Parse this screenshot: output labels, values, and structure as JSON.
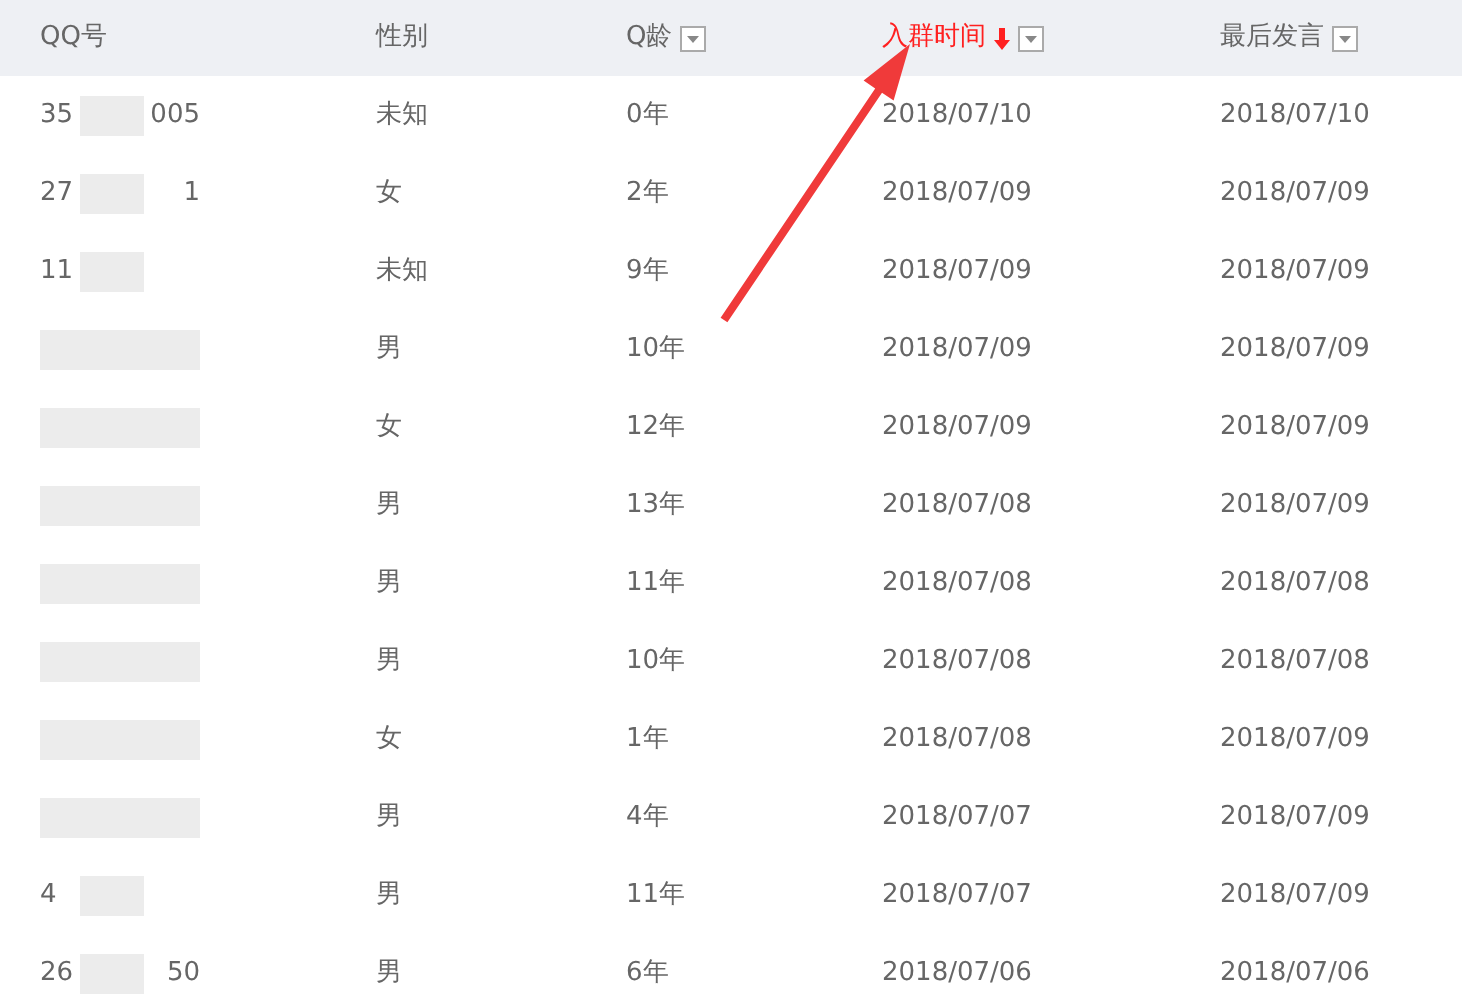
{
  "table": {
    "columns": [
      {
        "label": "QQ号",
        "filter": false,
        "sorted": false
      },
      {
        "label": "性别",
        "filter": false,
        "sorted": false
      },
      {
        "label": "Q龄",
        "filter": true,
        "sorted": false
      },
      {
        "label": "入群时间",
        "filter": true,
        "sorted": true
      },
      {
        "label": "最后发言",
        "filter": true,
        "sorted": false
      }
    ],
    "rows": [
      {
        "qq": {
          "start": "35",
          "end": "005"
        },
        "gender": "未知",
        "age": "0年",
        "joined": "2018/07/10",
        "last": "2018/07/10"
      },
      {
        "qq": {
          "start": "27",
          "end": "1"
        },
        "gender": "女",
        "age": "2年",
        "joined": "2018/07/09",
        "last": "2018/07/09"
      },
      {
        "qq": {
          "start": "11"
        },
        "gender": "未知",
        "age": "9年",
        "joined": "2018/07/09",
        "last": "2018/07/09"
      },
      {
        "qq": {},
        "gender": "男",
        "age": "10年",
        "joined": "2018/07/09",
        "last": "2018/07/09"
      },
      {
        "qq": {},
        "gender": "女",
        "age": "12年",
        "joined": "2018/07/09",
        "last": "2018/07/09"
      },
      {
        "qq": {},
        "gender": "男",
        "age": "13年",
        "joined": "2018/07/08",
        "last": "2018/07/09"
      },
      {
        "qq": {},
        "gender": "男",
        "age": "11年",
        "joined": "2018/07/08",
        "last": "2018/07/08"
      },
      {
        "qq": {},
        "gender": "男",
        "age": "10年",
        "joined": "2018/07/08",
        "last": "2018/07/08"
      },
      {
        "qq": {},
        "gender": "女",
        "age": "1年",
        "joined": "2018/07/08",
        "last": "2018/07/09"
      },
      {
        "qq": {},
        "gender": "男",
        "age": "4年",
        "joined": "2018/07/07",
        "last": "2018/07/09"
      },
      {
        "qq": {
          "start": "4"
        },
        "gender": "男",
        "age": "11年",
        "joined": "2018/07/07",
        "last": "2018/07/09"
      },
      {
        "qq": {
          "start": "26",
          "end": "50"
        },
        "gender": "男",
        "age": "6年",
        "joined": "2018/07/06",
        "last": "2018/07/06"
      }
    ]
  }
}
